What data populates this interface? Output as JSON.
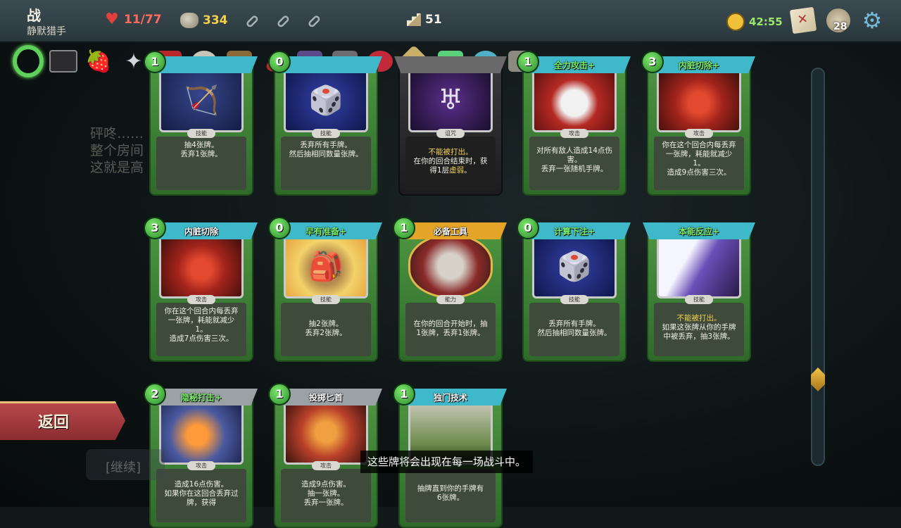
{
  "character": {
    "name": "战",
    "title": "静默猎手"
  },
  "stats": {
    "hp": "11/77",
    "gold": "334",
    "floor": "51",
    "timer": "42:55",
    "deck_count": "28"
  },
  "potions": [
    "empty-potion-slot",
    "empty-potion-slot",
    "empty-potion-slot"
  ],
  "relics": [
    "ring-of-the-snake-icon",
    "box-icon",
    "strawberry-icon",
    "shuriken-icon"
  ],
  "tip": {
    "lines": [
      "砰咚……",
      "整个房间",
      "这就是高"
    ]
  },
  "cards": [
    {
      "cost": "1",
      "name": "",
      "type": "技能",
      "desc": [
        "抽4张牌。",
        "丢弃1张牌。"
      ],
      "art": "bow"
    },
    {
      "cost": "0",
      "name": "",
      "type": "技能",
      "desc": [
        "丢弃所有手牌。",
        "然后抽相同数量张牌。"
      ],
      "art": "dice"
    },
    {
      "cost": "",
      "name": "",
      "type": "诅咒",
      "desc_kw": "不能被打出。",
      "desc": [
        "在你的回合结束时，获",
        "得1层"
      ],
      "desc_kw2": "虚弱",
      "desc_end": "。",
      "art": "curse"
    },
    {
      "cost": "1",
      "name": "全力攻击+",
      "type": "攻击",
      "desc": [
        "对所有敌人造成14点伤",
        "害。",
        "丢弃一张随机手牌。"
      ],
      "art": "blast"
    },
    {
      "cost": "3",
      "name": "内脏切除+",
      "type": "攻击",
      "desc": [
        "你在这个回合内每丢弃",
        "一张牌，耗能就减少",
        "1。",
        "造成9点伤害三次。"
      ],
      "art": "eviscerate"
    },
    {
      "cost": "3",
      "name": "内脏切除",
      "type": "攻击",
      "desc": [
        "你在这个回合内每丢弃",
        "一张牌，耗能就减少",
        "1。",
        "造成7点伤害三次。"
      ],
      "art": "eviscerate"
    },
    {
      "cost": "0",
      "name": "早有准备+",
      "type": "技能",
      "desc": [
        "抽2张牌。",
        "丢弃2张牌。"
      ],
      "art": "bag"
    },
    {
      "cost": "1",
      "name": "必备工具",
      "type": "能力",
      "desc": [
        "在你的回合开始时，抽",
        "1张牌，丢弃1张牌。"
      ],
      "art": "tools"
    },
    {
      "cost": "0",
      "name": "计算下注+",
      "type": "技能",
      "desc": [
        "丢弃所有手牌。",
        "然后抽相同数量张牌。"
      ],
      "art": "dice"
    },
    {
      "cost": "",
      "name": "本能反应+",
      "type": "技能",
      "desc_kw": "不能被打出。",
      "desc": [
        "如果这张牌从你的手牌",
        "中被丢弃，抽3张牌。"
      ],
      "art": "reflex"
    },
    {
      "cost": "2",
      "name": "隐秘打击+",
      "type": "攻击",
      "desc": [
        "造成16点伤害。",
        "如果你在这回合丢弃过",
        "牌，获得"
      ],
      "art": "sneak"
    },
    {
      "cost": "1",
      "name": "投掷匕首",
      "type": "攻击",
      "desc": [
        "造成9点伤害。",
        "抽一张牌。",
        "丢弃一张牌。"
      ],
      "art": "dagger"
    },
    {
      "cost": "1",
      "name": "独门技术",
      "type": "",
      "desc": [
        "抽牌直到你的手牌有",
        "6张牌。"
      ],
      "art": "secret"
    }
  ],
  "buttons": {
    "return": "返回",
    "continue": "[继续]"
  },
  "tooltip": "这些牌将会出现在每一场战斗中。",
  "colors": {
    "hp": "#ff6a5c",
    "gold": "#f4d04a",
    "timer": "#9be86a",
    "upgraded_name": "#7cf06a",
    "card_green": "#4e9642"
  }
}
